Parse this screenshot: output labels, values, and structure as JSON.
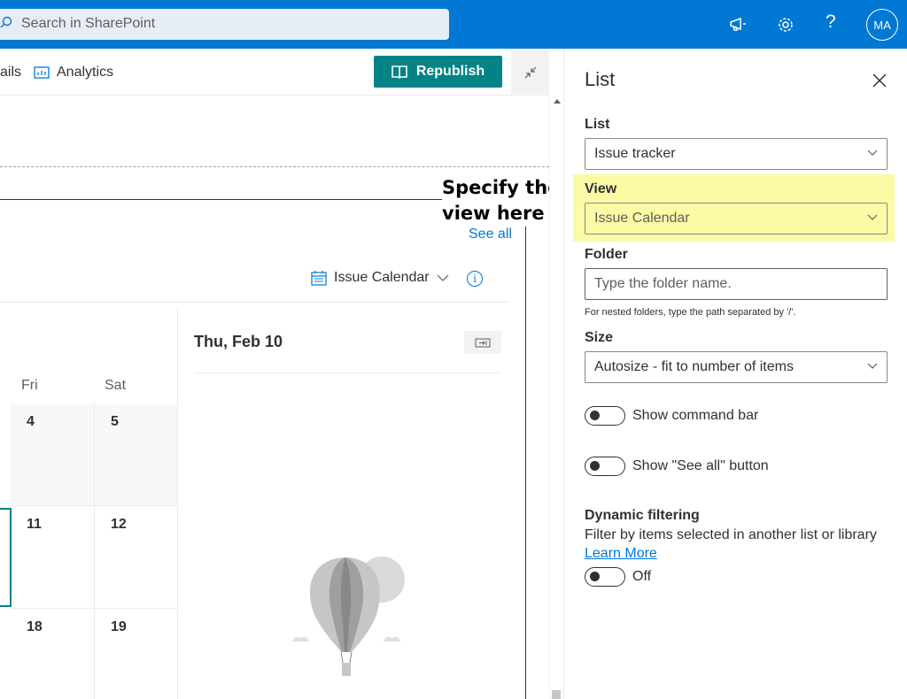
{
  "topbar": {
    "search_placeholder": "Search in SharePoint",
    "avatar_initials": "MA",
    "help_glyph": "?",
    "icons": [
      "search-icon",
      "megaphone-icon",
      "gear-icon",
      "help-icon"
    ],
    "colors": {
      "brand": "#0078d4"
    }
  },
  "commandbar": {
    "details_label": "ails",
    "analytics_label": "Analytics",
    "republish_label": "Republish",
    "colors": {
      "republish": "#038387"
    }
  },
  "webpart": {
    "annotation": [
      "Specify the",
      "view here"
    ],
    "see_all": "See all",
    "view_name": "Issue Calendar",
    "info_glyph": "i",
    "calendar": {
      "day_headers": [
        "Fri",
        "Sat"
      ],
      "rows": [
        [
          "4",
          "5"
        ],
        [
          "11",
          "12"
        ],
        [
          "18",
          "19"
        ]
      ]
    },
    "selected_date": "Thu, Feb 10"
  },
  "pane": {
    "title": "List",
    "list_label": "List",
    "list_value": "Issue tracker",
    "view_label": "View",
    "view_value": "Issue Calendar",
    "folder_label": "Folder",
    "folder_placeholder": "Type the folder name.",
    "folder_helper": "For nested folders, type the path separated by '/'.",
    "size_label": "Size",
    "size_value": "Autosize - fit to number of items",
    "toggles": {
      "command_bar": {
        "label": "Show command bar",
        "on": false
      },
      "see_all": {
        "label": "Show \"See all\" button",
        "on": false
      },
      "dynamic_filtering": {
        "label": "Off",
        "on": false
      }
    },
    "dynamic_filtering_title": "Dynamic filtering",
    "dynamic_filtering_desc": "Filter by items selected in another list or library",
    "learn_more": "Learn More",
    "colors": {
      "highlight": "#fbfba6"
    }
  }
}
